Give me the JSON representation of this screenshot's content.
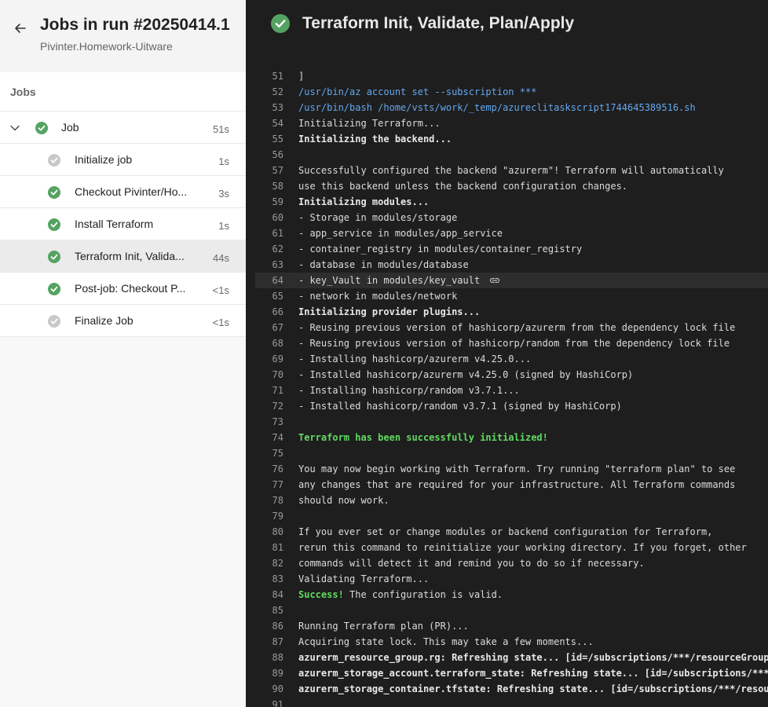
{
  "header": {
    "title": "Jobs in run #20250414.1",
    "subtitle": "Pivinter.Homework-Uitware",
    "back_icon": "arrow-left-icon"
  },
  "jobs_section": {
    "label": "Jobs"
  },
  "job": {
    "label": "Job",
    "duration": "51s",
    "status": "success"
  },
  "steps": [
    {
      "label": "Initialize job",
      "duration": "1s",
      "status": "skipped"
    },
    {
      "label": "Checkout Pivinter/Ho...",
      "duration": "3s",
      "status": "success"
    },
    {
      "label": "Install Terraform",
      "duration": "1s",
      "status": "success"
    },
    {
      "label": "Terraform Init, Valida...",
      "duration": "44s",
      "status": "success",
      "selected": true
    },
    {
      "label": "Post-job: Checkout P...",
      "duration": "<1s",
      "status": "success"
    },
    {
      "label": "Finalize Job",
      "duration": "<1s",
      "status": "skipped"
    }
  ],
  "log_panel": {
    "title": "Terraform Init, Validate, Plan/Apply",
    "status": "success"
  },
  "log_lines": [
    {
      "n": "51",
      "t": "]",
      "s": ""
    },
    {
      "n": "52",
      "t": "/usr/bin/az account set --subscription ***",
      "s": "blue"
    },
    {
      "n": "53",
      "t": "/usr/bin/bash /home/vsts/work/_temp/azureclitaskscript1744645389516.sh",
      "s": "blue"
    },
    {
      "n": "54",
      "t": "Initializing Terraform...",
      "s": ""
    },
    {
      "n": "55",
      "t": "Initializing the backend...",
      "s": "bold"
    },
    {
      "n": "56",
      "t": "",
      "s": ""
    },
    {
      "n": "57",
      "t": "Successfully configured the backend \"azurerm\"! Terraform will automatically",
      "s": ""
    },
    {
      "n": "58",
      "t": "use this backend unless the backend configuration changes.",
      "s": ""
    },
    {
      "n": "59",
      "t": "Initializing modules...",
      "s": "bold"
    },
    {
      "n": "60",
      "t": "- Storage in modules/storage",
      "s": ""
    },
    {
      "n": "61",
      "t": "- app_service in modules/app_service",
      "s": ""
    },
    {
      "n": "62",
      "t": "- container_registry in modules/container_registry",
      "s": ""
    },
    {
      "n": "63",
      "t": "- database in modules/database",
      "s": ""
    },
    {
      "n": "64",
      "t": "- key_Vault in modules/key_vault",
      "s": "",
      "highlight": true
    },
    {
      "n": "65",
      "t": "- network in modules/network",
      "s": ""
    },
    {
      "n": "66",
      "t": "Initializing provider plugins...",
      "s": "bold"
    },
    {
      "n": "67",
      "t": "- Reusing previous version of hashicorp/azurerm from the dependency lock file",
      "s": ""
    },
    {
      "n": "68",
      "t": "- Reusing previous version of hashicorp/random from the dependency lock file",
      "s": ""
    },
    {
      "n": "69",
      "t": "- Installing hashicorp/azurerm v4.25.0...",
      "s": ""
    },
    {
      "n": "70",
      "t": "- Installed hashicorp/azurerm v4.25.0 (signed by HashiCorp)",
      "s": ""
    },
    {
      "n": "71",
      "t": "- Installing hashicorp/random v3.7.1...",
      "s": ""
    },
    {
      "n": "72",
      "t": "- Installed hashicorp/random v3.7.1 (signed by HashiCorp)",
      "s": ""
    },
    {
      "n": "73",
      "t": "",
      "s": ""
    },
    {
      "n": "74",
      "t": "Terraform has been successfully initialized!",
      "s": "green"
    },
    {
      "n": "75",
      "t": "",
      "s": ""
    },
    {
      "n": "76",
      "t": "You may now begin working with Terraform. Try running \"terraform plan\" to see",
      "s": ""
    },
    {
      "n": "77",
      "t": "any changes that are required for your infrastructure. All Terraform commands",
      "s": ""
    },
    {
      "n": "78",
      "t": "should now work.",
      "s": ""
    },
    {
      "n": "79",
      "t": "",
      "s": ""
    },
    {
      "n": "80",
      "t": "If you ever set or change modules or backend configuration for Terraform,",
      "s": ""
    },
    {
      "n": "81",
      "t": "rerun this command to reinitialize your working directory. If you forget, other",
      "s": ""
    },
    {
      "n": "82",
      "t": "commands will detect it and remind you to do so if necessary.",
      "s": ""
    },
    {
      "n": "83",
      "t": "Validating Terraform...",
      "s": ""
    },
    {
      "n": "84",
      "t": " The configuration is valid.",
      "s": "",
      "prefix": "Success!"
    },
    {
      "n": "85",
      "t": "",
      "s": ""
    },
    {
      "n": "86",
      "t": "Running Terraform plan (PR)...",
      "s": ""
    },
    {
      "n": "87",
      "t": "Acquiring state lock. This may take a few moments...",
      "s": ""
    },
    {
      "n": "88",
      "t": "azurerm_resource_group.rg: Refreshing state... [id=/subscriptions/***/resourceGroup",
      "s": "bold"
    },
    {
      "n": "89",
      "t": "azurerm_storage_account.terraform_state: Refreshing state... [id=/subscriptions/***",
      "s": "bold"
    },
    {
      "n": "90",
      "t": "azurerm_storage_container.tfstate: Refreshing state... [id=/subscriptions/***/resou",
      "s": "bold"
    },
    {
      "n": "91",
      "t": "",
      "s": ""
    }
  ],
  "colors": {
    "success": "#55a362",
    "skipped": "#c8c8c8",
    "log_bg": "#1e1e1e",
    "link_blue": "#64a8f0",
    "success_text": "#62d962"
  }
}
